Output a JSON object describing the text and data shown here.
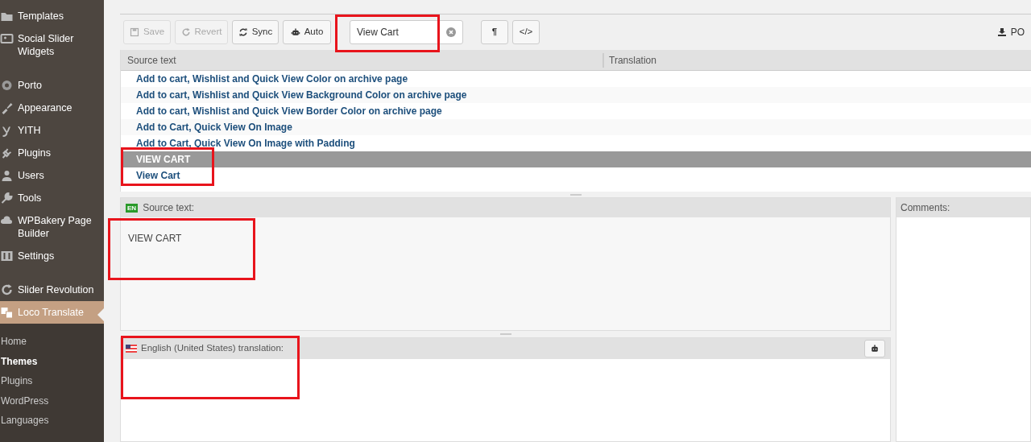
{
  "sidebar": {
    "items": [
      {
        "label": "Templates",
        "active": false
      },
      {
        "label": "Social Slider Widgets",
        "active": false
      },
      {
        "label": "Porto",
        "active": false
      },
      {
        "label": "Appearance",
        "active": false
      },
      {
        "label": "YITH",
        "active": false
      },
      {
        "label": "Plugins",
        "active": false
      },
      {
        "label": "Users",
        "active": false
      },
      {
        "label": "Tools",
        "active": false
      },
      {
        "label": "WPBakery Page Builder",
        "active": false
      },
      {
        "label": "Settings",
        "active": false
      },
      {
        "label": "Slider Revolution",
        "active": false
      },
      {
        "label": "Loco Translate",
        "active": true
      }
    ],
    "submenu": [
      {
        "label": "Home",
        "selected": false
      },
      {
        "label": "Themes",
        "selected": true
      },
      {
        "label": "Plugins",
        "selected": false
      },
      {
        "label": "WordPress",
        "selected": false
      },
      {
        "label": "Languages",
        "selected": false
      }
    ]
  },
  "toolbar": {
    "buttons": [
      {
        "label": "Save",
        "disabled": true
      },
      {
        "label": "Revert",
        "disabled": true
      },
      {
        "label": "Sync",
        "disabled": false
      },
      {
        "label": "Auto",
        "disabled": false
      }
    ],
    "search": {
      "value": "View Cart"
    },
    "format_buttons": [
      {
        "label": "¶"
      },
      {
        "label": "</>"
      }
    ],
    "download": {
      "label": "PO"
    }
  },
  "table": {
    "columns": [
      "Source text",
      "Translation"
    ],
    "rows": [
      {
        "source": "Add to cart, Wishlist and Quick View Color on archive page",
        "selected": false
      },
      {
        "source": "Add to cart, Wishlist and Quick View Background Color on archive page",
        "selected": false
      },
      {
        "source": "Add to cart, Wishlist and Quick View Border Color on archive page",
        "selected": false
      },
      {
        "source": "Add to Cart, Quick View On Image",
        "selected": false
      },
      {
        "source": "Add to Cart, Quick View On Image with Padding",
        "selected": false
      },
      {
        "source": "VIEW CART",
        "selected": true
      },
      {
        "source": "View Cart",
        "selected": false
      }
    ]
  },
  "source_panel": {
    "badge": "EN",
    "label": "Source text:",
    "text": "VIEW CART"
  },
  "translation_panel": {
    "label": "English (United States) translation:"
  },
  "comments_panel": {
    "label": "Comments:"
  }
}
